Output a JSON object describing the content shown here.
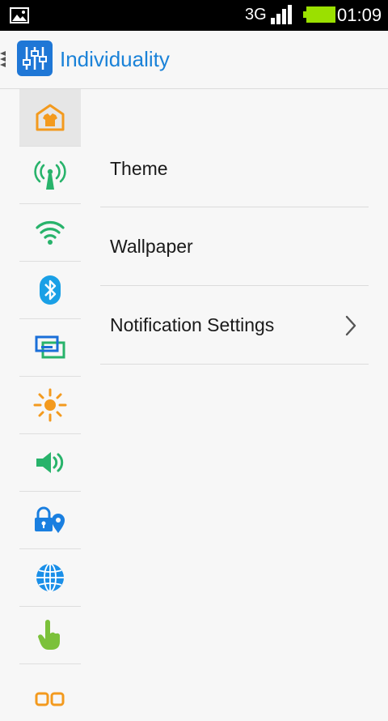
{
  "status_bar": {
    "network_type": "3G",
    "time": "01:09",
    "battery_color": "#9be000"
  },
  "action_bar": {
    "title": "Individuality",
    "accent_color": "#1a82d8",
    "app_icon": "sliders-icon"
  },
  "sidebar": {
    "items": [
      {
        "icon": "theme-house-icon",
        "selected": true
      },
      {
        "icon": "antenna-icon"
      },
      {
        "icon": "wifi-icon"
      },
      {
        "icon": "bluetooth-icon"
      },
      {
        "icon": "screens-icon"
      },
      {
        "icon": "brightness-sun-icon"
      },
      {
        "icon": "volume-icon"
      },
      {
        "icon": "lock-location-icon"
      },
      {
        "icon": "globe-icon"
      },
      {
        "icon": "hand-gesture-icon"
      },
      {
        "icon": "apps-grid-icon"
      }
    ]
  },
  "list": {
    "items": [
      {
        "label": "Theme",
        "has_chevron": false
      },
      {
        "label": "Wallpaper",
        "has_chevron": false
      },
      {
        "label": "Notification Settings",
        "has_chevron": true
      }
    ]
  }
}
